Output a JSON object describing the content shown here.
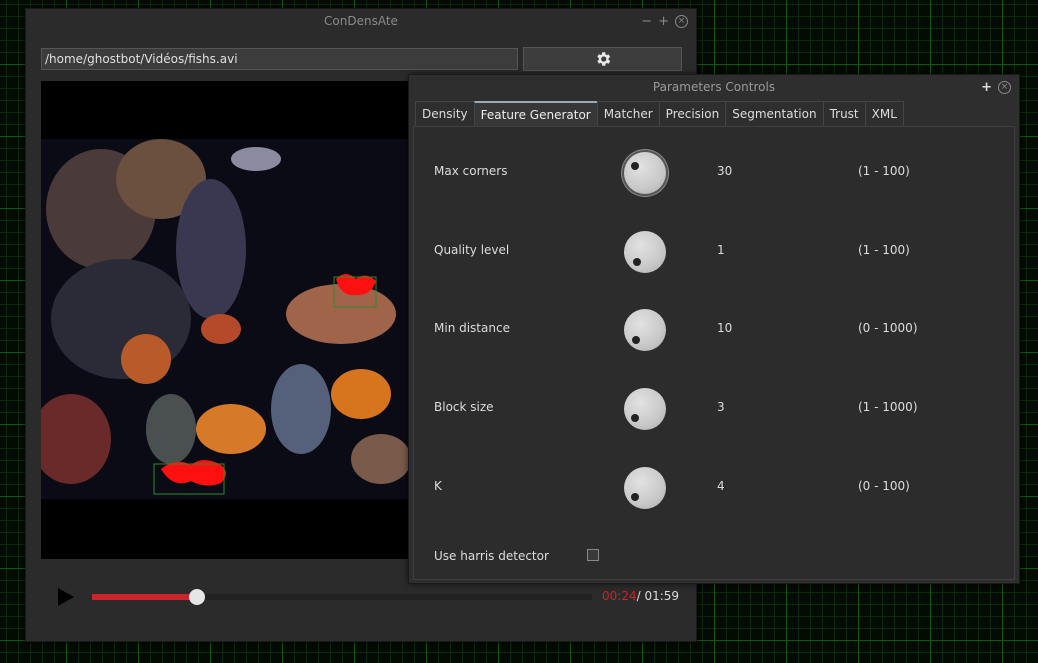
{
  "main_window": {
    "title": "ConDensAte",
    "minimize_glyph": "−",
    "maximize_glyph": "+",
    "close_glyph": "×",
    "file_path": "/home/ghostbot/Vidéos/fishs.avi",
    "settings_icon": "gear-icon",
    "player": {
      "current_time": "00:24",
      "total_time": "/ 01:59",
      "progress": 0.21
    }
  },
  "params_window": {
    "title": "Parameters Controls",
    "maximize_glyph": "+",
    "close_glyph": "×",
    "tabs": [
      "Density",
      "Feature Generator",
      "Matcher",
      "Precision",
      "Segmentation",
      "Trust",
      "XML"
    ],
    "active_tab": 1,
    "controls": [
      {
        "label": "Max corners",
        "value": "30",
        "range": "(1 - 100)"
      },
      {
        "label": "Quality level",
        "value": "1",
        "range": "(1 - 100)"
      },
      {
        "label": "Min distance",
        "value": "10",
        "range": "(0 - 1000)"
      },
      {
        "label": "Block size",
        "value": "3",
        "range": "(1 - 1000)"
      },
      {
        "label": "K",
        "value": "4",
        "range": "(0 - 100)"
      }
    ],
    "harris_label": "Use harris detector",
    "harris_checked": false
  },
  "colors": {
    "accent_red": "#c9252a",
    "grid_green": "#0f5a0f"
  }
}
